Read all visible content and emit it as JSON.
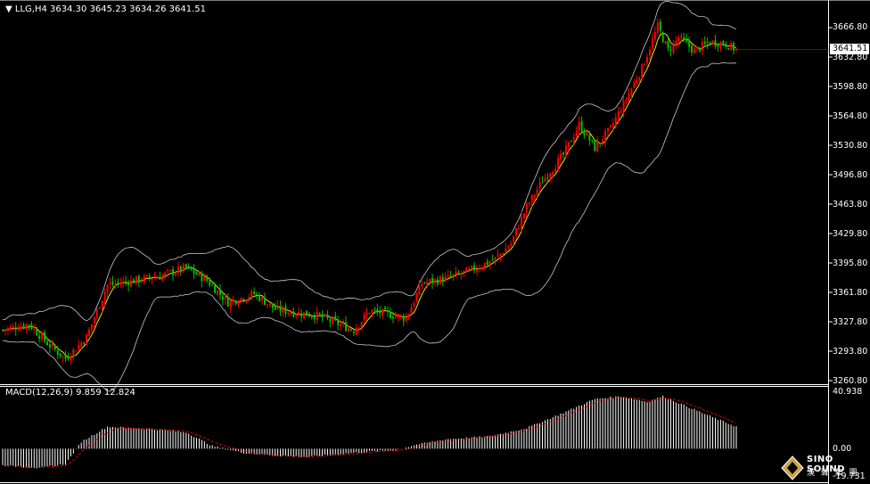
{
  "header": {
    "symbol": "LLG,H4",
    "ohlc": "3634.30 3645.23 3634.26 3641.51"
  },
  "macd_header": {
    "label": "MACD(12,26,9) 9.859 12.824"
  },
  "current_price": "3641.51",
  "price_axis": [
    "3666.80",
    "3632.80",
    "3598.80",
    "3564.80",
    "3530.80",
    "3496.80",
    "3463.80",
    "3429.80",
    "3395.80",
    "3361.80",
    "3327.80",
    "3293.80",
    "3260.80"
  ],
  "macd_axis": [
    "40.938",
    "0.00",
    "-19.731"
  ],
  "logo": {
    "line1": "SINO SOUND",
    "line2": "漢 聲 集 團",
    "icon": "diamond-logo-icon"
  },
  "colors": {
    "up": "#ff0000",
    "down": "#00c000",
    "bb": "#c8c8c8",
    "ma": "#ffff00",
    "macd_hist": "#ffffff",
    "signal": "#ff0000",
    "grid": "#ffffff"
  },
  "chart_data": {
    "type": "candlestick",
    "symbol": "LLG",
    "timeframe": "H4",
    "ylim": [
      3260.8,
      3680
    ],
    "macd_ylim": [
      -19.731,
      40.938
    ],
    "anchors": [
      [
        0,
        3318
      ],
      [
        10,
        3325
      ],
      [
        18,
        3300
      ],
      [
        24,
        3285
      ],
      [
        32,
        3310
      ],
      [
        40,
        3370
      ],
      [
        50,
        3375
      ],
      [
        60,
        3380
      ],
      [
        70,
        3390
      ],
      [
        78,
        3375
      ],
      [
        86,
        3350
      ],
      [
        96,
        3360
      ],
      [
        104,
        3342
      ],
      [
        112,
        3338
      ],
      [
        120,
        3335
      ],
      [
        128,
        3325
      ],
      [
        134,
        3318
      ],
      [
        140,
        3340
      ],
      [
        148,
        3336
      ],
      [
        154,
        3332
      ],
      [
        160,
        3372
      ],
      [
        170,
        3378
      ],
      [
        178,
        3386
      ],
      [
        188,
        3400
      ],
      [
        194,
        3418
      ],
      [
        200,
        3460
      ],
      [
        206,
        3490
      ],
      [
        214,
        3520
      ],
      [
        220,
        3555
      ],
      [
        226,
        3528
      ],
      [
        232,
        3550
      ],
      [
        238,
        3585
      ],
      [
        244,
        3620
      ],
      [
        250,
        3668
      ],
      [
        254,
        3640
      ],
      [
        258,
        3655
      ],
      [
        264,
        3640
      ],
      [
        270,
        3650
      ],
      [
        276,
        3648
      ],
      [
        280,
        3641
      ]
    ],
    "macd_anchors": [
      [
        0,
        -12
      ],
      [
        14,
        -14
      ],
      [
        24,
        -11
      ],
      [
        30,
        5
      ],
      [
        40,
        16
      ],
      [
        58,
        14
      ],
      [
        70,
        12
      ],
      [
        80,
        2
      ],
      [
        92,
        -3
      ],
      [
        104,
        -5
      ],
      [
        116,
        -6
      ],
      [
        128,
        -4
      ],
      [
        140,
        -2
      ],
      [
        150,
        -1
      ],
      [
        158,
        3
      ],
      [
        170,
        7
      ],
      [
        186,
        9
      ],
      [
        200,
        15
      ],
      [
        214,
        26
      ],
      [
        226,
        36
      ],
      [
        236,
        38
      ],
      [
        246,
        34
      ],
      [
        252,
        38
      ],
      [
        262,
        30
      ],
      [
        272,
        22
      ],
      [
        280,
        16
      ]
    ]
  }
}
